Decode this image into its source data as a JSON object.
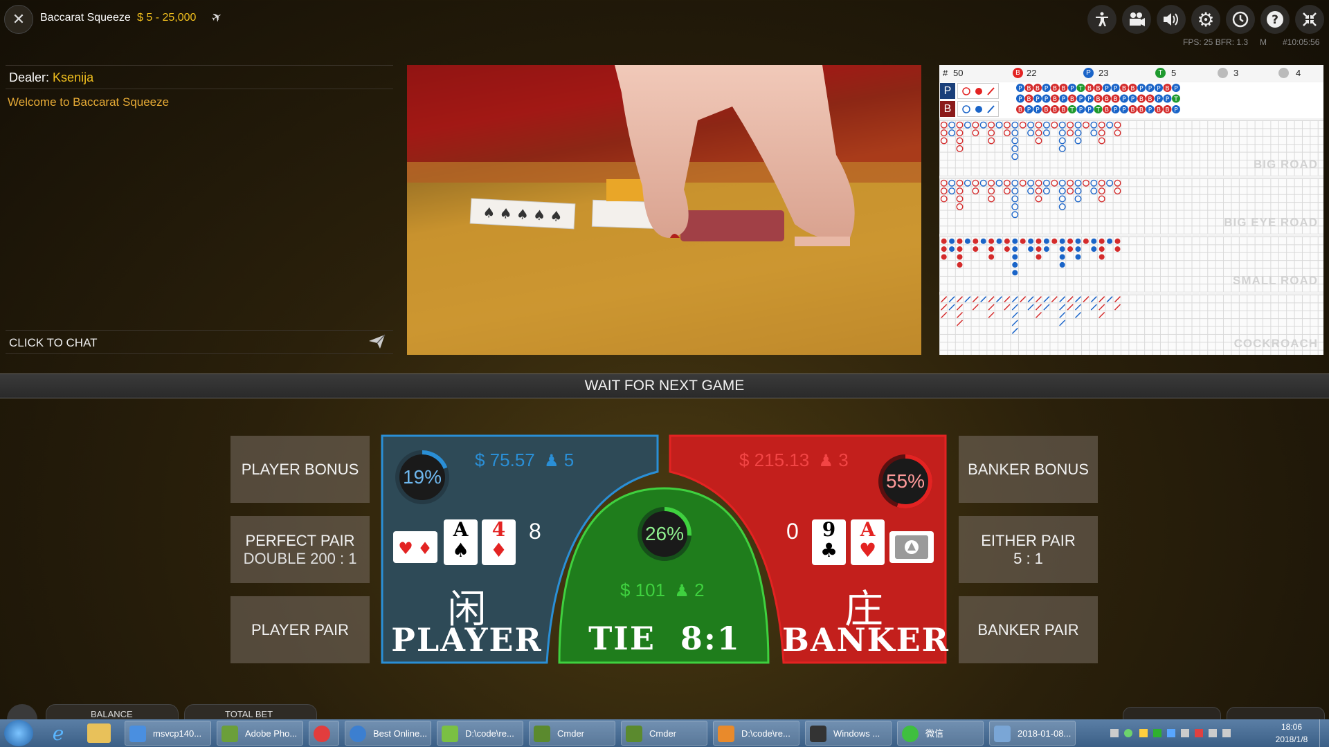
{
  "header": {
    "table_name": "Baccarat Squeeze",
    "limits": "$ 5 - 25,000",
    "stats": "FPS: 25 BFR: 1.3",
    "stats_mode": "M",
    "round_id": "#10:05:56",
    "icons": [
      "accessibility-icon",
      "camera-icon",
      "volume-icon",
      "gear-icon",
      "history-icon",
      "help-icon",
      "fullscreen-icon"
    ]
  },
  "chat": {
    "dealer_label": "Dealer:",
    "dealer_name": "Ksenija",
    "welcome": "Welcome to Baccarat Squeeze",
    "click_to_chat": "CLICK TO CHAT"
  },
  "roads": {
    "total_label": "#",
    "total": "50",
    "banker_badge": "B",
    "banker_count": "22",
    "player_badge": "P",
    "player_count": "23",
    "tie_badge": "T",
    "tie_count": "5",
    "banker_pair_count": "3",
    "player_pair_count": "4",
    "predict_player": "P",
    "predict_banker": "B",
    "big_road": "BIG ROAD",
    "big_eye_road": "BIG EYE ROAD",
    "small_road": "SMALL ROAD",
    "cockroach": "COCKROACH"
  },
  "status": "WAIT FOR NEXT GAME",
  "bets": {
    "player_bonus": "PLAYER BONUS",
    "perfect_pair_line1": "PERFECT PAIR",
    "perfect_pair_line2": "DOUBLE 200 : 1",
    "player_pair": "PLAYER PAIR",
    "banker_bonus": "BANKER BONUS",
    "either_pair_line1": "EITHER PAIR",
    "either_pair_line2": "5 : 1",
    "banker_pair": "BANKER PAIR",
    "player": {
      "percent_label": "19%",
      "percent": 19,
      "amount": "$ 75.57",
      "players": "5",
      "score": "8",
      "cjk": "闲",
      "word": "PLAYER",
      "card1_rank": "A",
      "card1_suit": "♠",
      "card2_rank": "4",
      "card2_suit": "♦"
    },
    "tie": {
      "percent_label": "26%",
      "percent": 26,
      "amount": "$ 101",
      "players": "2",
      "word": "TIE",
      "payout": "8:1"
    },
    "banker": {
      "percent_label": "55%",
      "percent": 55,
      "amount": "$ 215.13",
      "players": "3",
      "score": "0",
      "cjk": "庄",
      "word": "BANKER",
      "card1_rank": "9",
      "card1_suit": "♣",
      "card2_rank": "A",
      "card2_suit": "♥"
    },
    "colors": {
      "player": "#2a8fd6",
      "banker": "#e32322",
      "tie": "#3fd13f"
    }
  },
  "footer": {
    "balance_label": "BALANCE",
    "total_bet_label": "TOTAL BET"
  },
  "taskbar": {
    "items": [
      "msvcp140...",
      "Adobe Pho...",
      "",
      "Best Online...",
      "D:\\code\\re...",
      "Cmder",
      "Cmder",
      "D:\\code\\re...",
      "Windows ...",
      "微信",
      "2018-01-08..."
    ],
    "time": "18:06",
    "date": "2018/1/8"
  }
}
